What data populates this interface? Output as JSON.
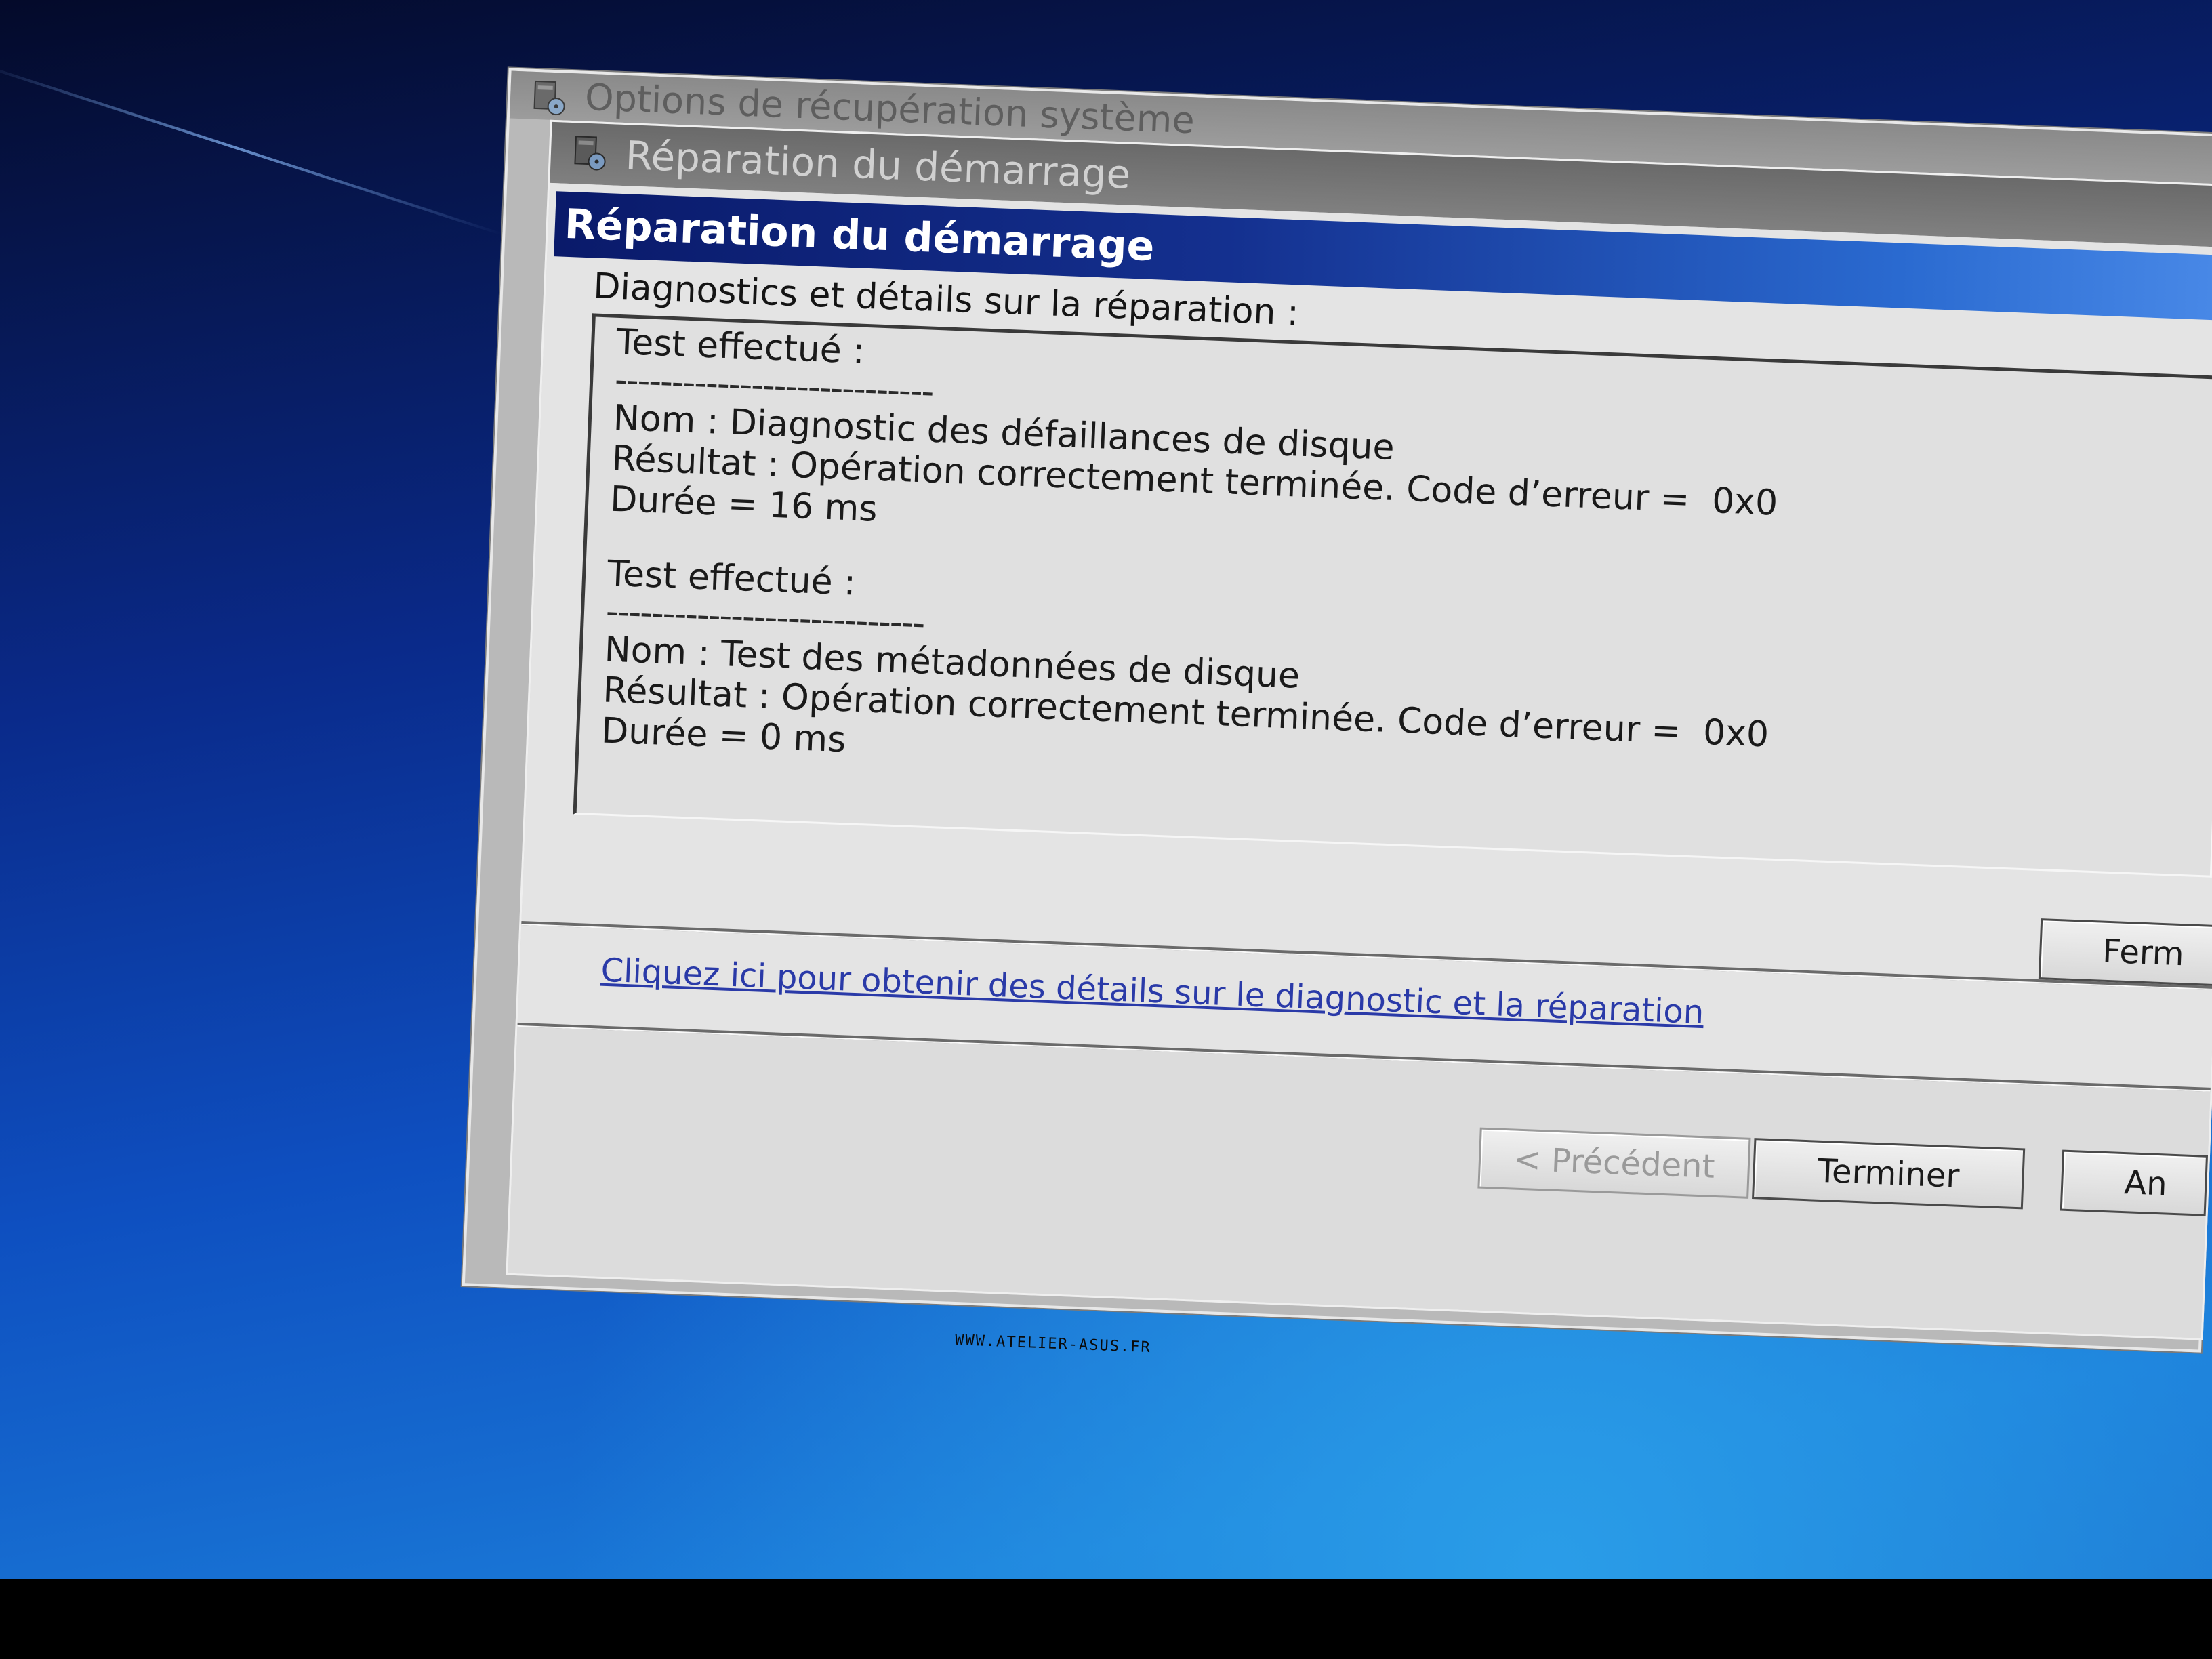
{
  "outer_window": {
    "title": "Options de récupération système",
    "icon": "computer-disk-icon"
  },
  "inner_window": {
    "title": "Réparation du démarrage",
    "icon": "computer-disk-icon"
  },
  "dialog": {
    "header": "Réparation du démarrage",
    "details_label": "Diagnostics et détails sur la réparation :",
    "tests": [
      {
        "heading": "Test effectué :",
        "separator": "----------------------------",
        "name": "Nom : Diagnostic des défaillances de disque",
        "result": "Résultat : Opération correctement terminée. Code d’erreur =  0x0",
        "duration": "Durée = 16 ms"
      },
      {
        "heading": "Test effectué :",
        "separator": "----------------------------",
        "name": "Nom : Test des métadonnées de disque",
        "result": "Résultat : Opération correctement terminée. Code d’erreur =  0x0",
        "duration": "Durée = 0 ms"
      }
    ],
    "close_button": "Ferm"
  },
  "link": {
    "text": "Cliquez ici pour obtenir des détails sur le diagnostic et la réparation"
  },
  "buttons": {
    "previous": "< Précédent",
    "finish": "Terminer",
    "cancel": "An"
  },
  "watermark": "WWW.ATELIER-ASUS.FR",
  "colors": {
    "header_gradient_start": "#0a1a6a",
    "header_gradient_end": "#4a8ae8",
    "link": "#2a3aa8",
    "desktop_blue": "#0e4fc0"
  }
}
